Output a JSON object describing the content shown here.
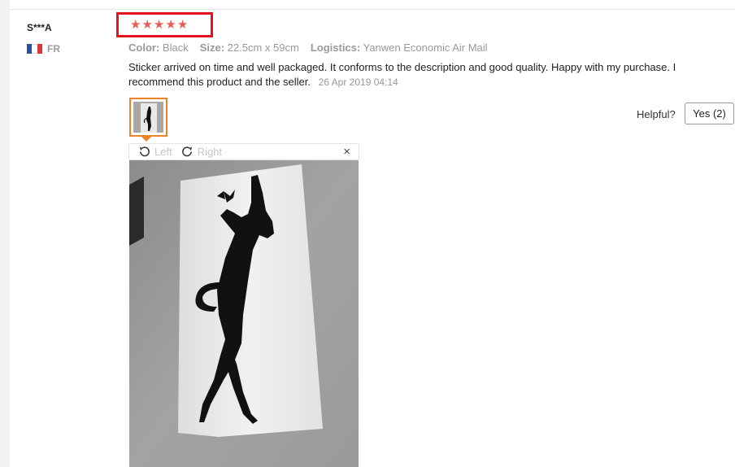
{
  "review": {
    "user": "S***A",
    "country": "FR",
    "rating": 5,
    "star_color": "#e95c55",
    "meta": {
      "color_label": "Color:",
      "color_value": "Black",
      "size_label": "Size:",
      "size_value": "22.5cm x 59cm",
      "logistics_label": "Logistics:",
      "logistics_value": "Yanwen Economic Air Mail"
    },
    "text": "Sticker arrived on time and well packaged. It conforms to the description and good quality. Happy with my purchase. I recommend this product and the seller.",
    "date": "26 Apr 2019 04:14",
    "helpful_label": "Helpful?",
    "yes_label": "Yes (2)"
  },
  "viewer": {
    "left_label": "Left",
    "right_label": "Right",
    "close_glyph": "×"
  },
  "colors": {
    "highlight_border": "#e3141f",
    "thumb_border": "#f08226"
  }
}
